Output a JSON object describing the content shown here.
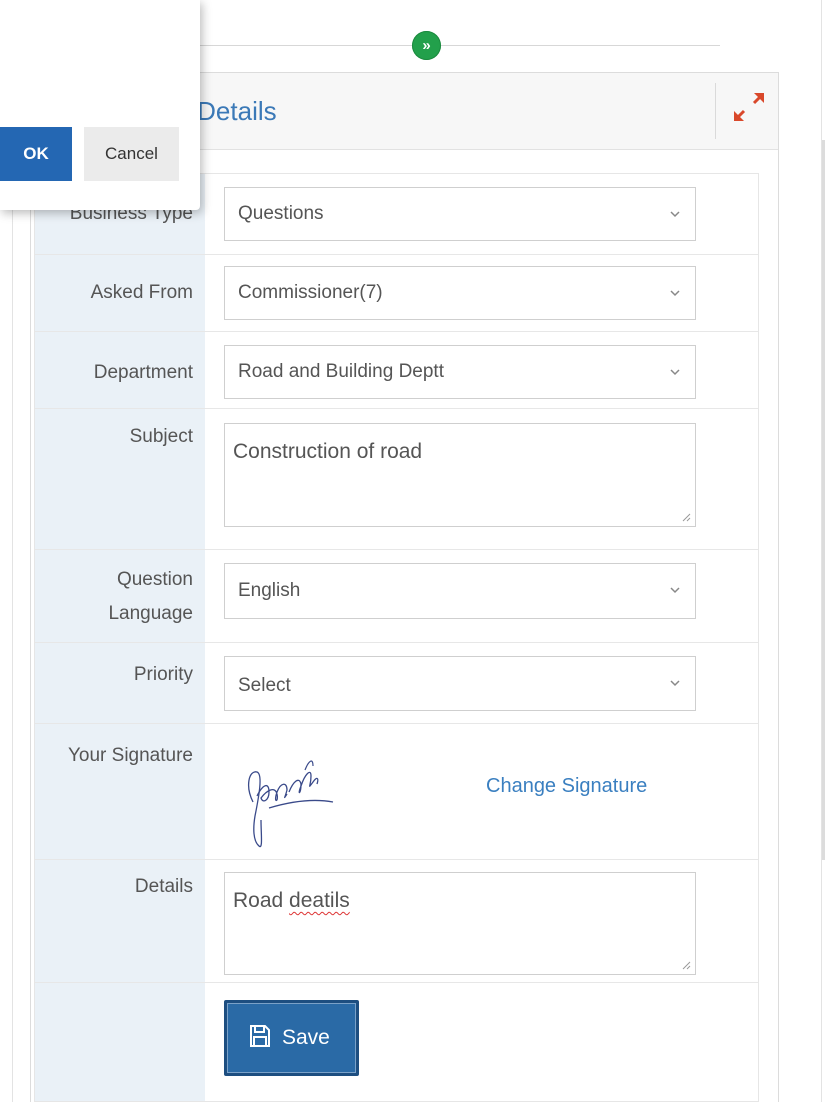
{
  "progress": {
    "step_icon": "double-chevron-right-icon",
    "color": "#22a04b"
  },
  "panel": {
    "title": "on Details",
    "expand_icon": "expand-arrows-icon"
  },
  "form": {
    "business_type": {
      "label": "Business Type",
      "value": "Questions"
    },
    "asked_from": {
      "label": "Asked From",
      "value": "Commissioner(7)"
    },
    "department": {
      "label": "Department",
      "value": "Road and Building Deptt"
    },
    "subject": {
      "label": "Subject",
      "value": "Construction of road"
    },
    "question_language": {
      "label_line1": "Question",
      "label_line2": "Language",
      "value": "English"
    },
    "priority": {
      "label": "Priority",
      "value": "Select"
    },
    "signature": {
      "label": "Your Signature",
      "change_link": "Change Signature"
    },
    "details": {
      "label": "Details",
      "value_part1": "Road ",
      "value_part2": "deatils"
    },
    "save": {
      "label": "Save",
      "icon": "floppy-disk-icon"
    }
  },
  "dialog": {
    "ok_label": "OK",
    "cancel_label": "Cancel"
  },
  "colors": {
    "accent_blue": "#2467b3",
    "link_blue": "#3a7fc0",
    "label_bg": "#eaf1f7",
    "save_blue": "#2a6aa6"
  }
}
